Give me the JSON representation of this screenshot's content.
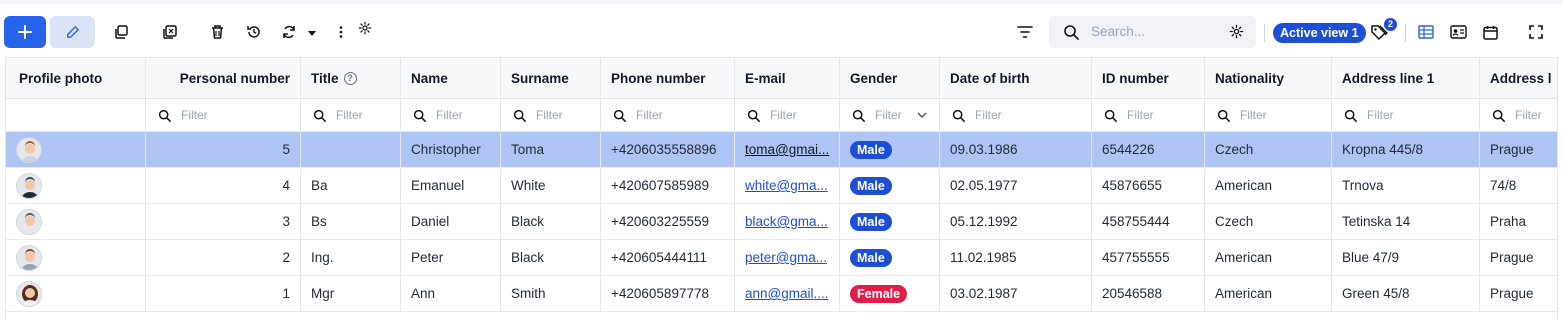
{
  "toolbar": {
    "add_icon": "plus-icon",
    "edit_icon": "pencil-icon",
    "search_placeholder": "Search...",
    "active_view_label": "Active view 1",
    "tag_count": "2",
    "accent_color": "#2563eb"
  },
  "grid": {
    "columns": [
      {
        "label": "Profile photo"
      },
      {
        "label": "Personal number"
      },
      {
        "label": "Title"
      },
      {
        "label": "Name"
      },
      {
        "label": "Surname"
      },
      {
        "label": "Phone number"
      },
      {
        "label": "E-mail"
      },
      {
        "label": "Gender"
      },
      {
        "label": "Date of birth"
      },
      {
        "label": "ID number"
      },
      {
        "label": "Nationality"
      },
      {
        "label": "Address line 1"
      },
      {
        "label": "Address l"
      }
    ],
    "filter_placeholder": "Filter",
    "rows": [
      {
        "photo_icon": "avatar-man-icon",
        "personal_number": "5",
        "title": "",
        "name": "Christopher",
        "surname": "Toma",
        "phone": "+4206035558896",
        "email": "toma@gmai...",
        "gender": "Male",
        "gender_color": "#1d4ed8",
        "dob": "09.03.1986",
        "id_number": "6544226",
        "nationality": "Czech",
        "address1": "Kropna 445/8",
        "address2": "Prague",
        "selected": true
      },
      {
        "photo_icon": "avatar-man-icon",
        "personal_number": "4",
        "title": "Ba",
        "name": "Emanuel",
        "surname": "White",
        "phone": "+420607585989",
        "email": "white@gma...",
        "gender": "Male",
        "gender_color": "#1d4ed8",
        "dob": "02.05.1977",
        "id_number": "45876655",
        "nationality": "American",
        "address1": "Trnova",
        "address2": "74/8",
        "selected": false
      },
      {
        "photo_icon": "avatar-man-icon",
        "personal_number": "3",
        "title": "Bs",
        "name": "Daniel",
        "surname": "Black",
        "phone": "+420603225559",
        "email": "black@gma...",
        "gender": "Male",
        "gender_color": "#1d4ed8",
        "dob": "05.12.1992",
        "id_number": "458755444",
        "nationality": "Czech",
        "address1": "Tetinska 14",
        "address2": "Praha",
        "selected": false
      },
      {
        "photo_icon": "avatar-man-icon",
        "personal_number": "2",
        "title": "Ing.",
        "name": "Peter",
        "surname": "Black",
        "phone": "+420605444111",
        "email": "peter@gma...",
        "gender": "Male",
        "gender_color": "#1d4ed8",
        "dob": "11.02.1985",
        "id_number": "457755555",
        "nationality": "American",
        "address1": "Blue 47/9",
        "address2": "Prague",
        "selected": false
      },
      {
        "photo_icon": "avatar-woman-icon",
        "personal_number": "1",
        "title": "Mgr",
        "name": "Ann",
        "surname": "Smith",
        "phone": "+420605897778",
        "email": "ann@gmail....",
        "gender": "Female",
        "gender_color": "#e11d48",
        "dob": "03.02.1987",
        "id_number": "20546588",
        "nationality": "American",
        "address1": "Green 45/8",
        "address2": "Prague",
        "selected": false
      }
    ]
  }
}
